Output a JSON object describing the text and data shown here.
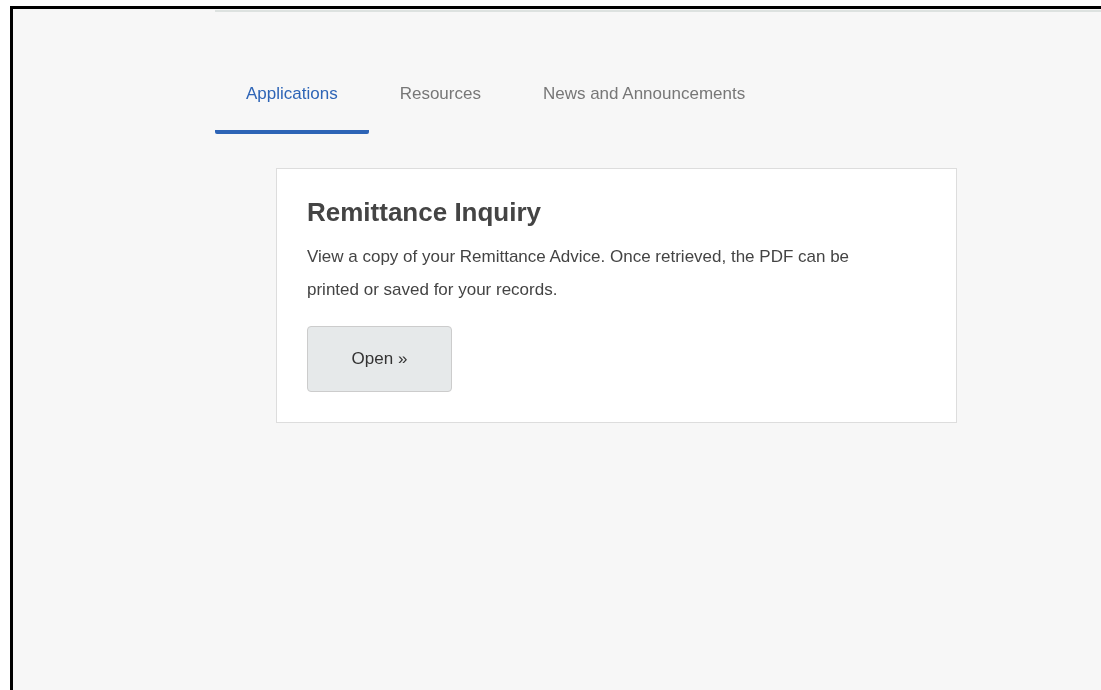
{
  "tabs": [
    {
      "label": "Applications",
      "selected": true
    },
    {
      "label": "Resources",
      "selected": false
    },
    {
      "label": "News and Announcements",
      "selected": false
    }
  ],
  "cards": [
    {
      "title": "Remittance Inquiry",
      "description": "View a copy of your Remittance Advice. Once retrieved, the PDF can be printed or saved for your records.",
      "button": "Open »"
    }
  ]
}
